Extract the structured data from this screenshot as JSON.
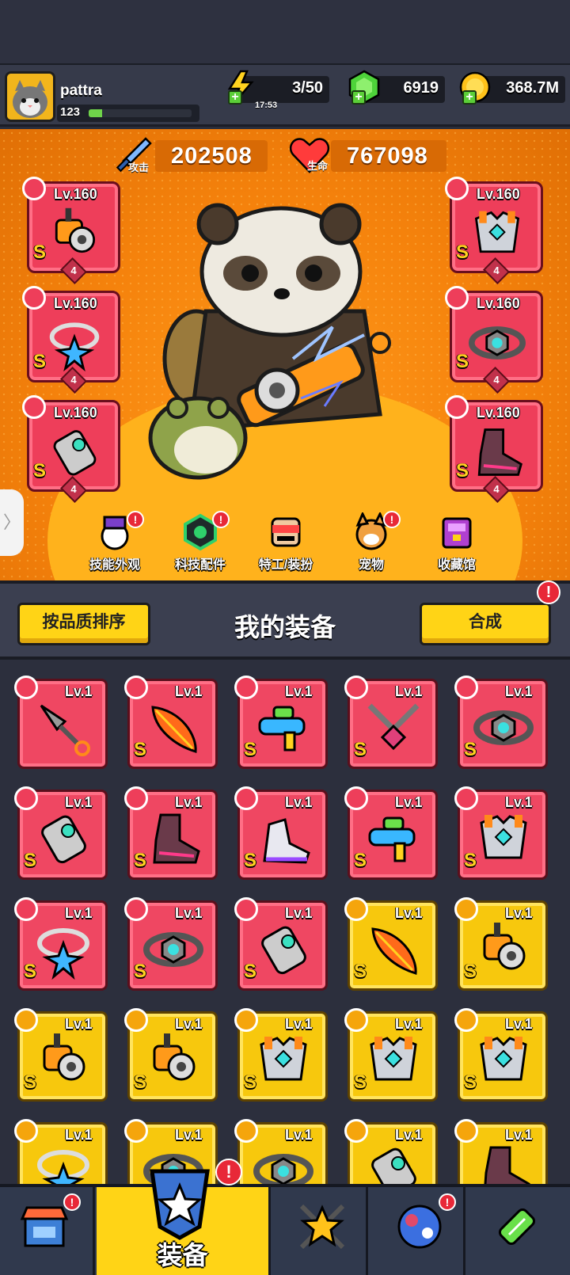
{
  "player": {
    "name": "pattra",
    "level": "123",
    "xp_progress": 0.13
  },
  "resources": {
    "energy": {
      "value": "3/50",
      "timer": "17:53",
      "icon": "lightning-icon"
    },
    "gems": {
      "value": "6919",
      "icon": "gem-icon"
    },
    "gold": {
      "value": "368.7M",
      "icon": "coin-icon"
    }
  },
  "stats": {
    "attack": {
      "label": "攻击",
      "value": "202508",
      "icon": "sword-icon"
    },
    "hp": {
      "label": "生命",
      "value": "767098",
      "icon": "heart-icon"
    }
  },
  "equipped": {
    "left": [
      {
        "level": "Lv.160",
        "grade": "S",
        "count": "4",
        "item": "cannon-weapon-icon",
        "type": "weapon"
      },
      {
        "level": "Lv.160",
        "grade": "S",
        "count": "4",
        "item": "star-necklace-icon",
        "type": "necklace"
      },
      {
        "level": "Lv.160",
        "grade": "S",
        "count": "4",
        "item": "gauntlet-icon",
        "type": "gloves"
      }
    ],
    "right": [
      {
        "level": "Lv.160",
        "grade": "S",
        "count": "4",
        "item": "armor-icon",
        "type": "armor"
      },
      {
        "level": "Lv.160",
        "grade": "S",
        "count": "4",
        "item": "belt-icon",
        "type": "belt"
      },
      {
        "level": "Lv.160",
        "grade": "S",
        "count": "4",
        "item": "boots-icon",
        "type": "boots"
      }
    ]
  },
  "hero_menu": [
    {
      "label": "技能外观",
      "icon": "skill-skin-icon",
      "alert": "!"
    },
    {
      "label": "科技配件",
      "icon": "tech-part-icon",
      "alert": "!"
    },
    {
      "label": "特工/装扮",
      "icon": "agent-icon",
      "alert": ""
    },
    {
      "label": "宠物",
      "icon": "pet-icon",
      "alert": "!"
    },
    {
      "label": "收藏馆",
      "icon": "collection-icon",
      "alert": ""
    }
  ],
  "equip_header": {
    "sort_label": "按品质排序",
    "title": "我的装备",
    "merge_label": "合成",
    "merge_alert": "!"
  },
  "inventory": [
    {
      "level": "Lv.1",
      "grade": "",
      "quality": "red",
      "item": "kunai-icon"
    },
    {
      "level": "Lv.1",
      "grade": "S",
      "quality": "red",
      "item": "feather-icon"
    },
    {
      "level": "Lv.1",
      "grade": "S",
      "quality": "red",
      "item": "water-gun-icon"
    },
    {
      "level": "Lv.1",
      "grade": "S",
      "quality": "red",
      "item": "chain-necklace-icon"
    },
    {
      "level": "Lv.1",
      "grade": "S",
      "quality": "red",
      "item": "belt-icon"
    },
    {
      "level": "Lv.1",
      "grade": "S",
      "quality": "red",
      "item": "gauntlet-icon"
    },
    {
      "level": "Lv.1",
      "grade": "S",
      "quality": "red",
      "item": "boots-icon"
    },
    {
      "level": "Lv.1",
      "grade": "S",
      "quality": "red",
      "item": "sneaker-icon"
    },
    {
      "level": "Lv.1",
      "grade": "S",
      "quality": "red",
      "item": "water-gun-icon"
    },
    {
      "level": "Lv.1",
      "grade": "S",
      "quality": "red",
      "item": "armor-icon"
    },
    {
      "level": "Lv.1",
      "grade": "S",
      "quality": "red",
      "item": "star-necklace-icon"
    },
    {
      "level": "Lv.1",
      "grade": "S",
      "quality": "red",
      "item": "belt-icon"
    },
    {
      "level": "Lv.1",
      "grade": "S",
      "quality": "red",
      "item": "gauntlet-icon"
    },
    {
      "level": "Lv.1",
      "grade": "S",
      "quality": "gold",
      "item": "feather-icon"
    },
    {
      "level": "Lv.1",
      "grade": "S",
      "quality": "gold",
      "item": "cannon-weapon-icon"
    },
    {
      "level": "Lv.1",
      "grade": "S",
      "quality": "gold",
      "item": "cannon-weapon-icon"
    },
    {
      "level": "Lv.1",
      "grade": "S",
      "quality": "gold",
      "item": "cannon-weapon-icon"
    },
    {
      "level": "Lv.1",
      "grade": "S",
      "quality": "gold",
      "item": "armor-icon"
    },
    {
      "level": "Lv.1",
      "grade": "S",
      "quality": "gold",
      "item": "armor-icon"
    },
    {
      "level": "Lv.1",
      "grade": "S",
      "quality": "gold",
      "item": "armor-icon"
    },
    {
      "level": "Lv.1",
      "grade": "",
      "quality": "gold",
      "item": "star-necklace-icon"
    },
    {
      "level": "Lv.1",
      "grade": "",
      "quality": "gold",
      "item": "belt-icon"
    },
    {
      "level": "Lv.1",
      "grade": "",
      "quality": "gold",
      "item": "belt-icon"
    },
    {
      "level": "Lv.1",
      "grade": "",
      "quality": "gold",
      "item": "gauntlet-icon"
    },
    {
      "level": "Lv.1",
      "grade": "",
      "quality": "gold",
      "item": "boots-icon"
    }
  ],
  "bottom_nav": [
    {
      "label": "",
      "icon": "shop-icon",
      "alert": "!",
      "active": false
    },
    {
      "label": "装备",
      "icon": "equipment-icon",
      "alert": "!",
      "active": true
    },
    {
      "label": "",
      "icon": "star-swords-icon",
      "alert": "",
      "active": false
    },
    {
      "label": "",
      "icon": "planet-icon",
      "alert": "!",
      "active": false
    },
    {
      "label": "",
      "icon": "dna-icon",
      "alert": "",
      "active": false
    }
  ],
  "colors": {
    "hero_bg": "#f5820c",
    "red_quality": "#ef4762",
    "gold_quality": "#f7c80d",
    "accent_yellow": "#ffd416"
  }
}
